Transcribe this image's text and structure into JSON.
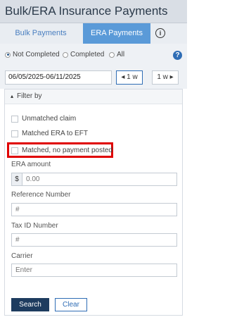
{
  "header": {
    "title": "Bulk/ERA Insurance Payments"
  },
  "tabs": [
    {
      "label": "Bulk Payments",
      "active": false
    },
    {
      "label": "ERA Payments",
      "active": true
    }
  ],
  "info_icon": {
    "icon": "info-icon",
    "glyph": "i"
  },
  "status_filter": {
    "options": [
      "Not Completed",
      "Completed",
      "All"
    ],
    "selected": "Not Completed"
  },
  "help_icon": {
    "icon": "help-icon",
    "glyph": "?"
  },
  "date": {
    "range": "06/05/2025-06/11/2025",
    "prev_label": "1 w",
    "next_label": "1 w"
  },
  "filter": {
    "header": "Filter by",
    "checkboxes": [
      {
        "label": "Unmatched claim",
        "checked": false
      },
      {
        "label": "Matched ERA to EFT",
        "checked": false
      },
      {
        "label": "Matched, no payment posted",
        "checked": false,
        "highlighted": true
      }
    ],
    "era_amount": {
      "label": "ERA amount",
      "currency": "$",
      "placeholder": "0.00"
    },
    "reference": {
      "label": "Reference Number",
      "placeholder": "#"
    },
    "tax_id": {
      "label": "Tax ID Number",
      "placeholder": "#"
    },
    "carrier": {
      "label": "Carrier",
      "placeholder": "Enter"
    }
  },
  "actions": {
    "search_label": "Search",
    "clear_label": "Clear"
  },
  "colors": {
    "accent": "#5a9ad8",
    "primary_button": "#1e3c5f",
    "highlight": "#e00000"
  }
}
